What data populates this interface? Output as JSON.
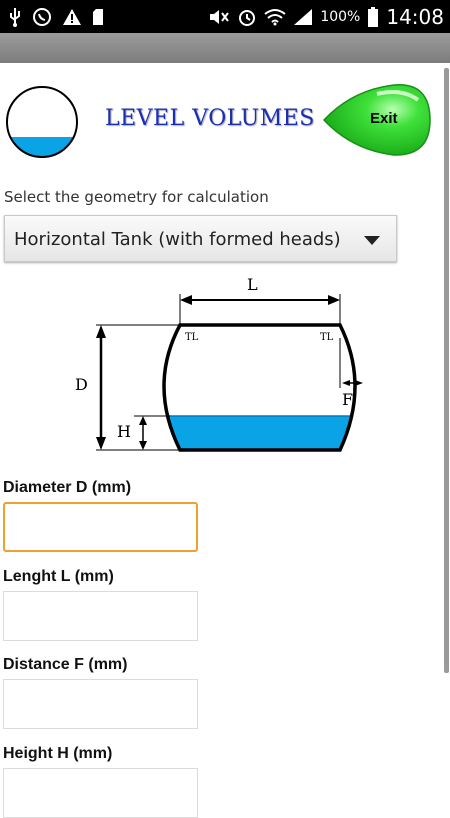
{
  "status_bar": {
    "battery_percent": "100%",
    "time": "14:08",
    "left_icons": [
      "usb-icon",
      "whatsapp-icon",
      "warning-icon",
      "sd-card-icon"
    ],
    "right_icons": [
      "mute-icon",
      "alarm-icon",
      "wifi-icon",
      "signal-icon",
      "battery-icon"
    ]
  },
  "header": {
    "title": "LEVEL VOLUMES",
    "exit_label": "Exit"
  },
  "geometry": {
    "prompt": "Select the geometry for calculation",
    "selected": "Horizontal Tank (with formed heads)"
  },
  "diagram": {
    "label_L": "L",
    "label_D": "D",
    "label_H": "H",
    "label_F": "F",
    "label_TL_left": "TL",
    "label_TL_right": "TL",
    "liquid_color": "#0aa4e6"
  },
  "fields": [
    {
      "label": "Diameter D (mm)",
      "value": "",
      "focused": true
    },
    {
      "label": "Lenght L (mm)",
      "value": "",
      "focused": false
    },
    {
      "label": "Distance F (mm)",
      "value": "",
      "focused": false
    },
    {
      "label": "Height H (mm)",
      "value": "",
      "focused": false
    }
  ],
  "colors": {
    "title_blue": "#1b2fb3",
    "exit_green": "#22d322",
    "focus_orange": "#f0a030"
  }
}
